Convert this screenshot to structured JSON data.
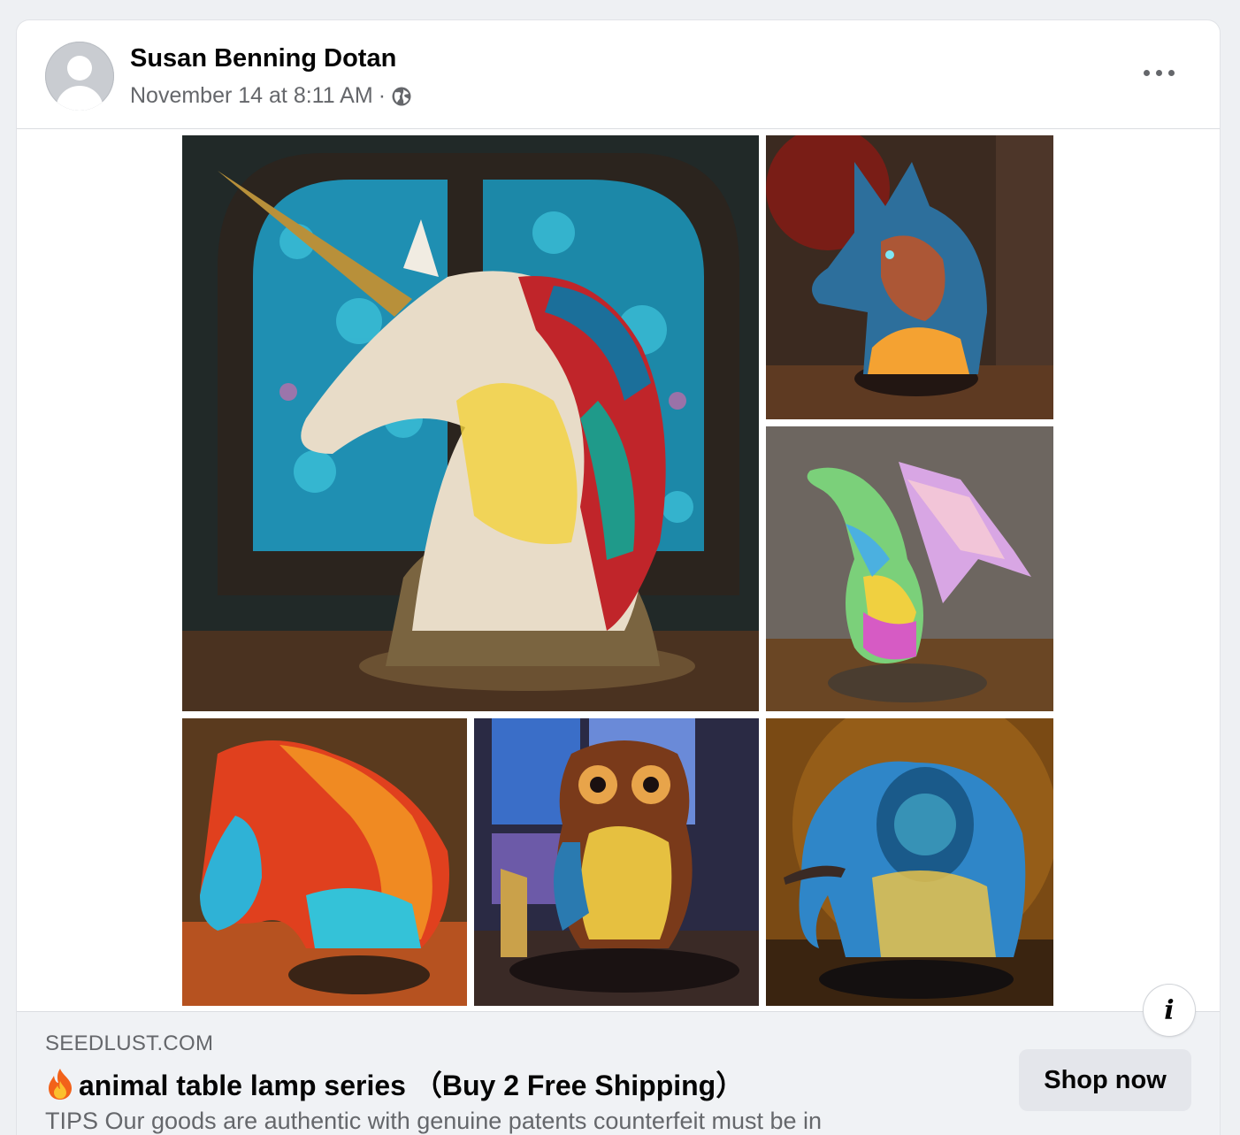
{
  "post": {
    "author": "Susan Benning Dotan",
    "timestamp": "November 14 at 8:11 AM",
    "separator": "·",
    "privacy_icon": "globe-icon",
    "more_icon": "more-horizontal-icon"
  },
  "media": {
    "tiles": [
      {
        "name": "unicorn-lamp-image",
        "subject": "unicorn"
      },
      {
        "name": "wolf-lamp-image",
        "subject": "wolf"
      },
      {
        "name": "dragon-lamp-image",
        "subject": "dragon"
      },
      {
        "name": "horse-lamp-image",
        "subject": "horse"
      },
      {
        "name": "owl-lamp-image",
        "subject": "owl"
      },
      {
        "name": "elephant-lamp-image",
        "subject": "elephant"
      }
    ]
  },
  "ad": {
    "domain": "SEEDLUST.COM",
    "headline": "animal table lamp series （Buy 2 Free Shipping）",
    "headline_icon": "fire-emoji-icon",
    "description": "TIPS Our goods are authentic with genuine patents counterfeit must be in",
    "cta": "Shop now",
    "info_icon": "info-icon",
    "info_label": "i"
  },
  "colors": {
    "text_primary": "#050505",
    "text_secondary": "#65676b",
    "footer_bg": "#f0f2f5",
    "button_bg": "#e4e6eb"
  }
}
